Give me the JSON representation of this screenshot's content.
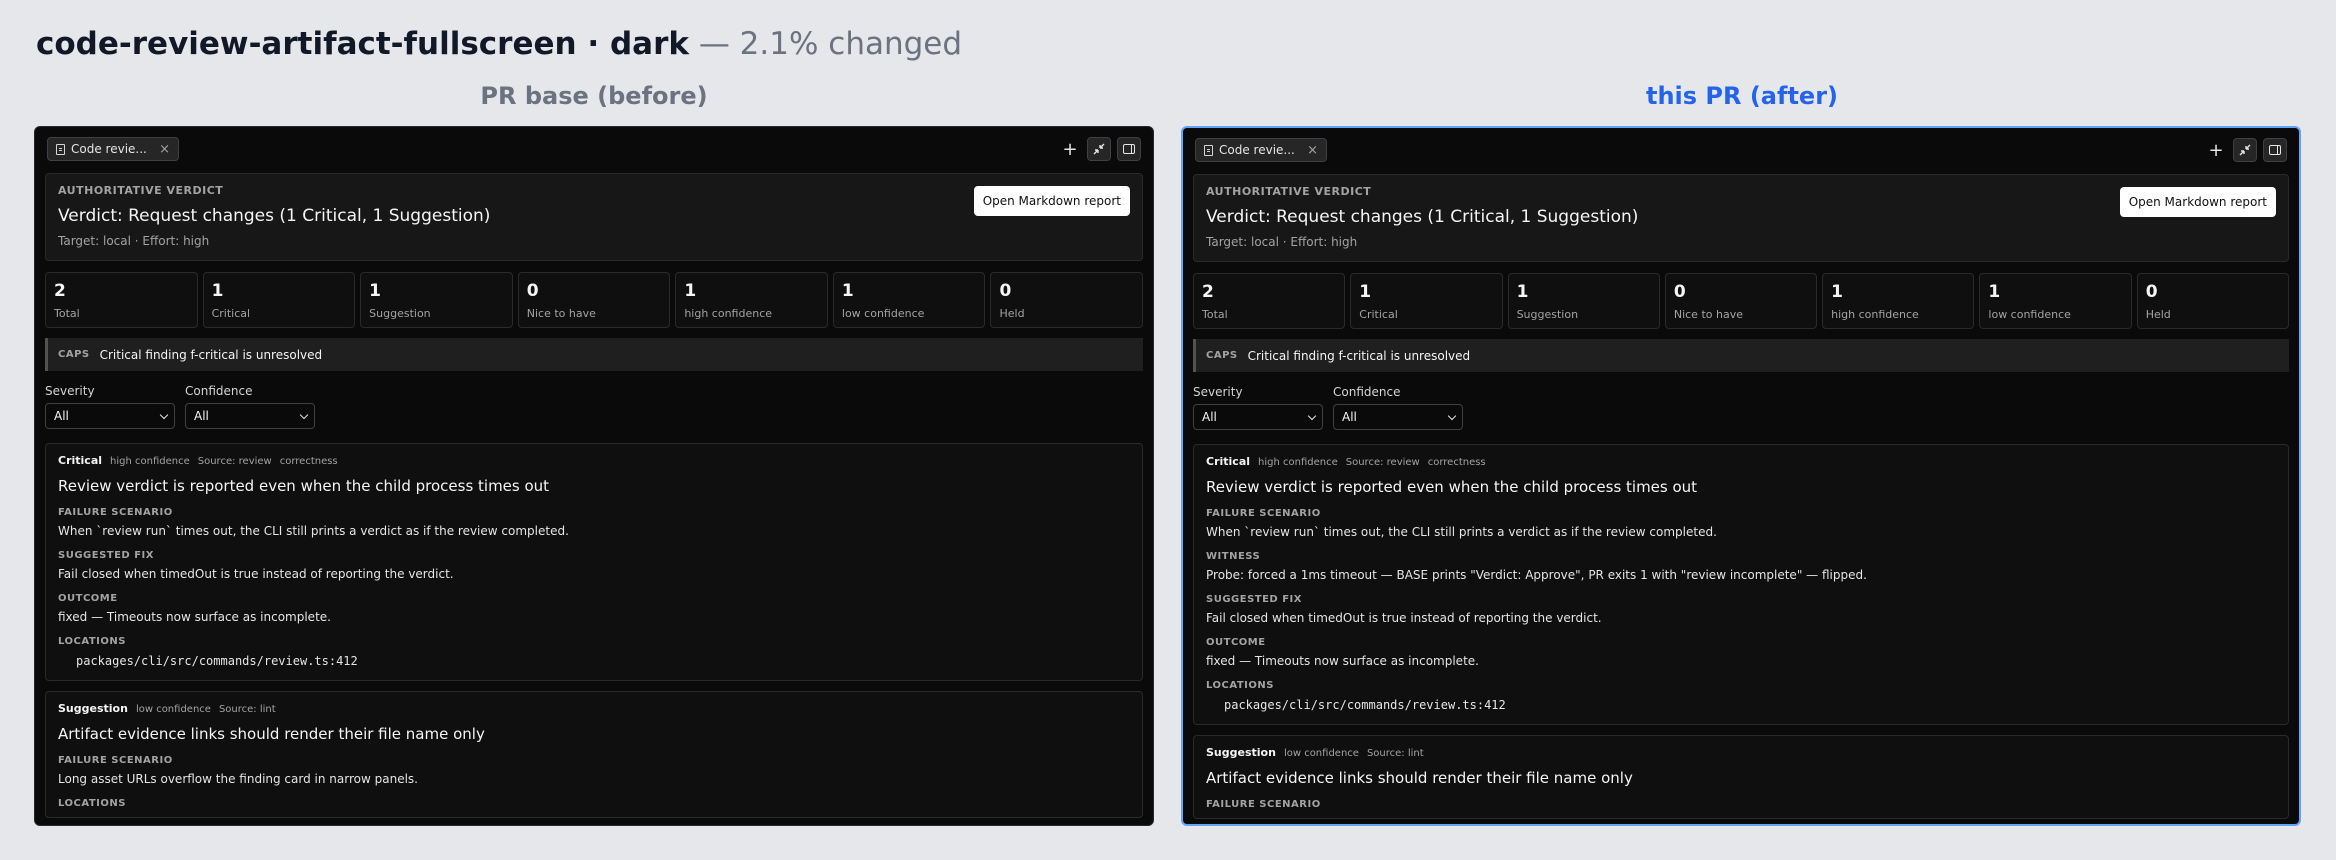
{
  "page": {
    "title_bold": "code-review-artifact-fullscreen · dark",
    "title_sub": " — 2.1% changed",
    "before_label": "PR base (before)",
    "after_label": "this PR (after)"
  },
  "toolbar": {
    "tab_label": "Code revie...",
    "tab_close": "×",
    "plus": "+",
    "collapse_icon": "collapse-icon",
    "panel_icon": "side-panel-icon"
  },
  "verdict": {
    "eyebrow": "AUTHORITATIVE VERDICT",
    "title": "Verdict: Request changes (1 Critical, 1 Suggestion)",
    "meta": "Target: local · Effort: high",
    "button": "Open Markdown report"
  },
  "stats": [
    {
      "value": "2",
      "label": "Total"
    },
    {
      "value": "1",
      "label": "Critical"
    },
    {
      "value": "1",
      "label": "Suggestion"
    },
    {
      "value": "0",
      "label": "Nice to have"
    },
    {
      "value": "1",
      "label": "high confidence"
    },
    {
      "value": "1",
      "label": "low confidence"
    },
    {
      "value": "0",
      "label": "Held"
    }
  ],
  "caps": {
    "tag": "CAPS",
    "text": "Critical finding f-critical is unresolved"
  },
  "filters": {
    "severity_label": "Severity",
    "severity_value": "All",
    "confidence_label": "Confidence",
    "confidence_value": "All"
  },
  "finding1": {
    "severity": "Critical",
    "confidence": "high confidence",
    "source": "Source: review",
    "category": "correctness",
    "title": "Review verdict is reported even when the child process times out",
    "failure_h": "FAILURE SCENARIO",
    "failure_b": "When `review run` times out, the CLI still prints a verdict as if the review completed.",
    "witness_h": "WITNESS",
    "witness_b": "Probe: forced a 1ms timeout — BASE prints \"Verdict: Approve\", PR exits 1 with \"review incomplete\" — flipped.",
    "fix_h": "SUGGESTED FIX",
    "fix_b": "Fail closed when timedOut is true instead of reporting the verdict.",
    "outcome_h": "OUTCOME",
    "outcome_b": "fixed — Timeouts now surface as incomplete.",
    "loc_h": "LOCATIONS",
    "loc_b": "packages/cli/src/commands/review.ts:412"
  },
  "finding2": {
    "severity": "Suggestion",
    "confidence": "low confidence",
    "source": "Source: lint",
    "title": "Artifact evidence links should render their file name only",
    "failure_h": "FAILURE SCENARIO",
    "failure_b": "Long asset URLs overflow the finding card in narrow panels.",
    "loc_h": "LOCATIONS"
  }
}
